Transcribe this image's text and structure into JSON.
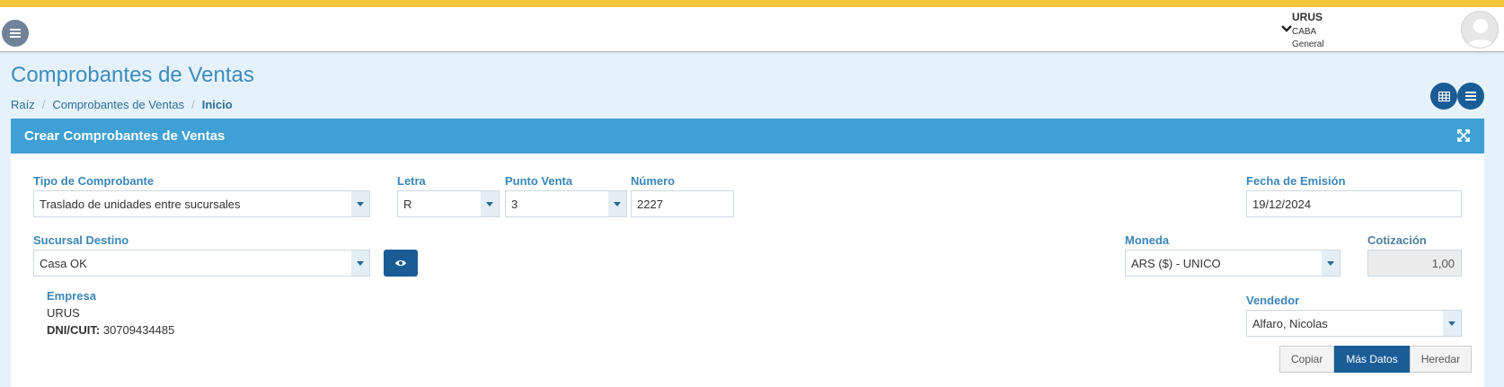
{
  "header": {
    "org_name": "URUS",
    "org_city": "CABA",
    "org_branch": "General"
  },
  "page": {
    "title": "Comprobantes de Ventas",
    "breadcrumb": [
      "Raíz",
      "Comprobantes de Ventas",
      "Inicio"
    ]
  },
  "panel": {
    "title": "Crear Comprobantes de Ventas"
  },
  "form": {
    "tipo_label": "Tipo de Comprobante",
    "tipo_value": "Traslado de unidades entre sucursales",
    "letra_label": "Letra",
    "letra_value": "R",
    "punto_label": "Punto Venta",
    "punto_value": "3",
    "numero_label": "Número",
    "numero_value": "2227",
    "fecha_label": "Fecha de Emisión",
    "fecha_value": "19/12/2024",
    "sucursal_label": "Sucursal Destino",
    "sucursal_value": "Casa OK",
    "moneda_label": "Moneda",
    "moneda_value": "ARS ($) - UNICO",
    "cotizacion_label": "Cotización",
    "cotizacion_value": "1,00",
    "vendedor_label": "Vendedor",
    "vendedor_value": "Alfaro, Nicolas"
  },
  "empresa": {
    "label": "Empresa",
    "name": "URUS",
    "dni_label": "DNI/CUIT:",
    "dni_value": "30709434485"
  },
  "actions": {
    "copiar": "Copiar",
    "mas_datos": "Más Datos",
    "heredar": "Heredar"
  },
  "icons": [
    "menu-icon",
    "chevron-down-icon",
    "avatar-icon",
    "grid-icon",
    "list-icon",
    "expand-icon",
    "eye-icon",
    "caret-down-icon"
  ],
  "colors": {
    "top_strip": "#f5c63c",
    "accent": "#3ea0d4",
    "primary_button": "#1a5c95",
    "page_bg": "#e6f2fb"
  }
}
